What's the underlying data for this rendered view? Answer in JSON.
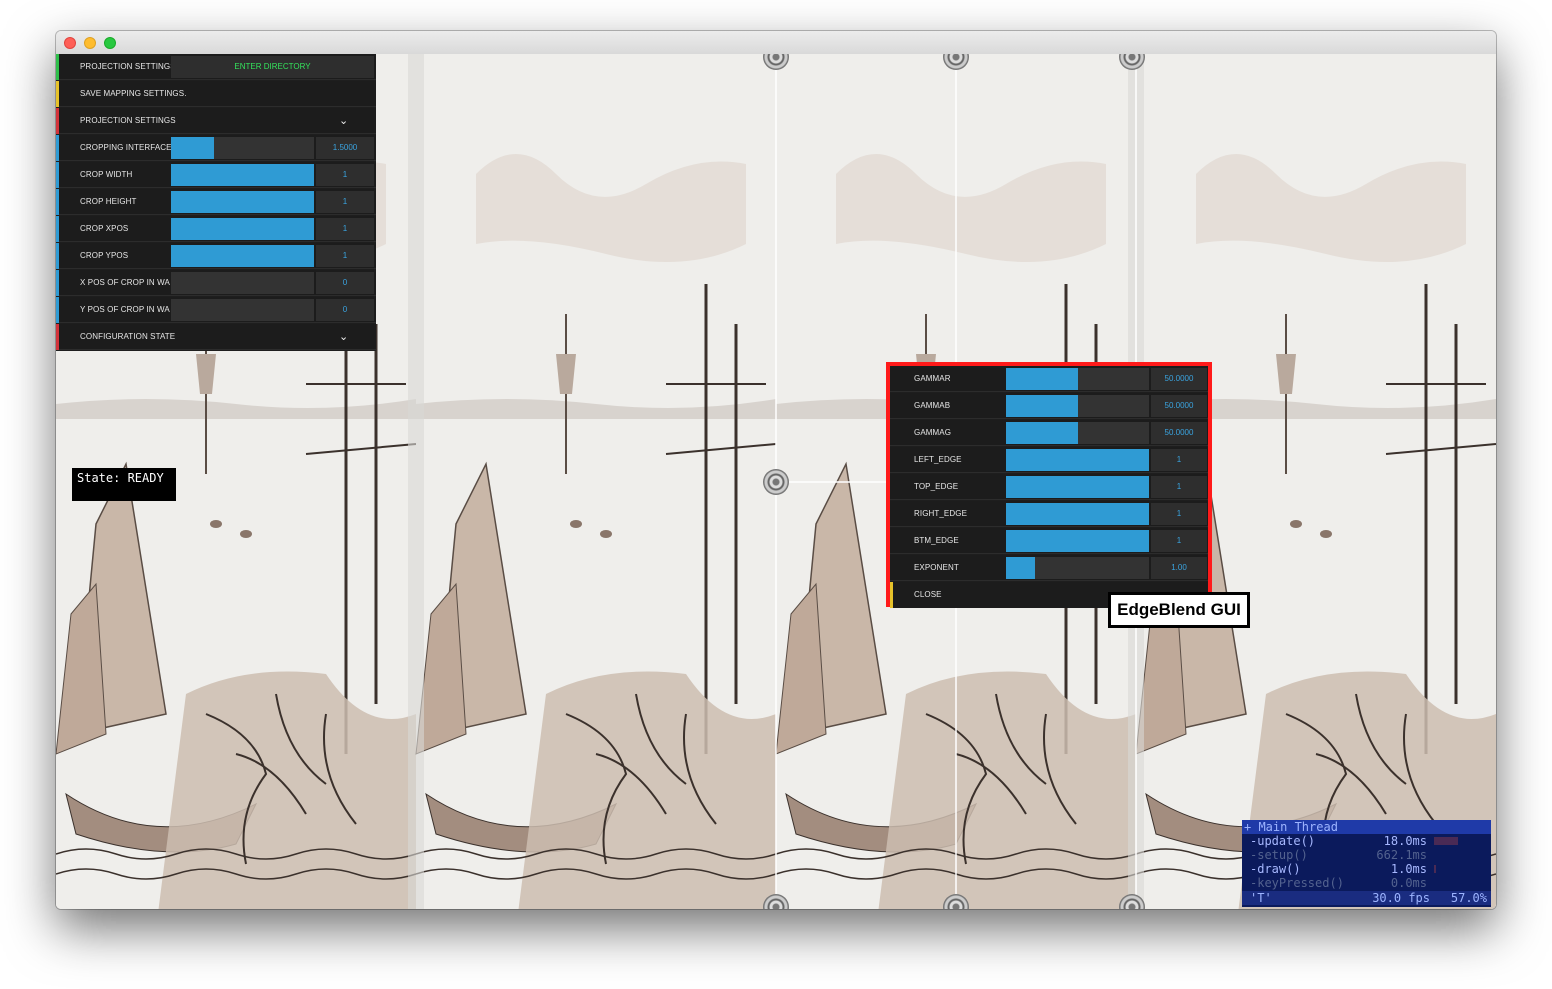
{
  "window": {
    "controls": [
      "close",
      "minimize",
      "zoom"
    ]
  },
  "left_gui": {
    "rows": [
      {
        "label": "PROJECTION SETTINGS",
        "button": "ENTER DIRECTORY",
        "accent": "#2fbf4a"
      },
      {
        "label": "SAVE MAPPING SETTINGS.",
        "accent": "#e6c22a"
      },
      {
        "label": "PROJECTION SETTINGS",
        "accent": "#d2323a",
        "chevron": "chevron-down-icon"
      },
      {
        "label": "CROPPING INTERFACE",
        "value": "1.5000",
        "fill": 0.3,
        "accent": "#2f9bd4"
      },
      {
        "label": "CROP WIDTH",
        "value": "1",
        "fill": 1,
        "accent": "#2f9bd4"
      },
      {
        "label": "CROP HEIGHT",
        "value": "1",
        "fill": 1,
        "accent": "#2f9bd4"
      },
      {
        "label": "CROP XPOS",
        "value": "1",
        "fill": 1,
        "accent": "#2f9bd4"
      },
      {
        "label": "CROP YPOS",
        "value": "1",
        "fill": 1,
        "accent": "#2f9bd4"
      },
      {
        "label": "X POS OF CROP IN WA",
        "value": "0",
        "fill": 0,
        "accent": "#2f9bd4"
      },
      {
        "label": "Y POS OF CROP IN WA",
        "value": "0",
        "fill": 0,
        "accent": "#2f9bd4"
      },
      {
        "label": "CONFIGURATION STATE",
        "accent": "#d2323a",
        "chevron": "chevron-down-icon"
      }
    ]
  },
  "state_label": "State: READY",
  "edgeblend_gui": {
    "border_color": "#ff1a1a",
    "rows": [
      {
        "label": "GAMMAR",
        "value": "50.0000",
        "fill": 0.5
      },
      {
        "label": "GAMMAB",
        "value": "50.0000",
        "fill": 0.5
      },
      {
        "label": "GAMMAG",
        "value": "50.0000",
        "fill": 0.5
      },
      {
        "label": "LEFT_EDGE",
        "value": "1",
        "fill": 1
      },
      {
        "label": "TOP_EDGE",
        "value": "1",
        "fill": 1
      },
      {
        "label": "RIGHT_EDGE",
        "value": "1",
        "fill": 1
      },
      {
        "label": "BTM_EDGE",
        "value": "1",
        "fill": 1
      },
      {
        "label": "EXPONENT",
        "value": "1.00",
        "fill": 0.2
      },
      {
        "label": "CLOSE"
      }
    ]
  },
  "callout_label": "EdgeBlend GUI",
  "profiler": {
    "header": "+ Main Thread",
    "rows": [
      {
        "name": "-update()",
        "time": "18.0ms",
        "active": true
      },
      {
        "name": "-setup()",
        "time": "662.1ms",
        "active": false
      },
      {
        "name": "-draw()",
        "time": "1.0ms",
        "active": true
      },
      {
        "name": "-keyPressed()",
        "time": "0.0ms",
        "active": false
      }
    ],
    "footer": {
      "key": "'T'",
      "fps": "30.0 fps",
      "load": "57.0%"
    }
  },
  "colors": {
    "accent_blue": "#2f9bd4",
    "gui_bg": "#1c1c1c",
    "profiler_bg": "#0b1a5c"
  }
}
